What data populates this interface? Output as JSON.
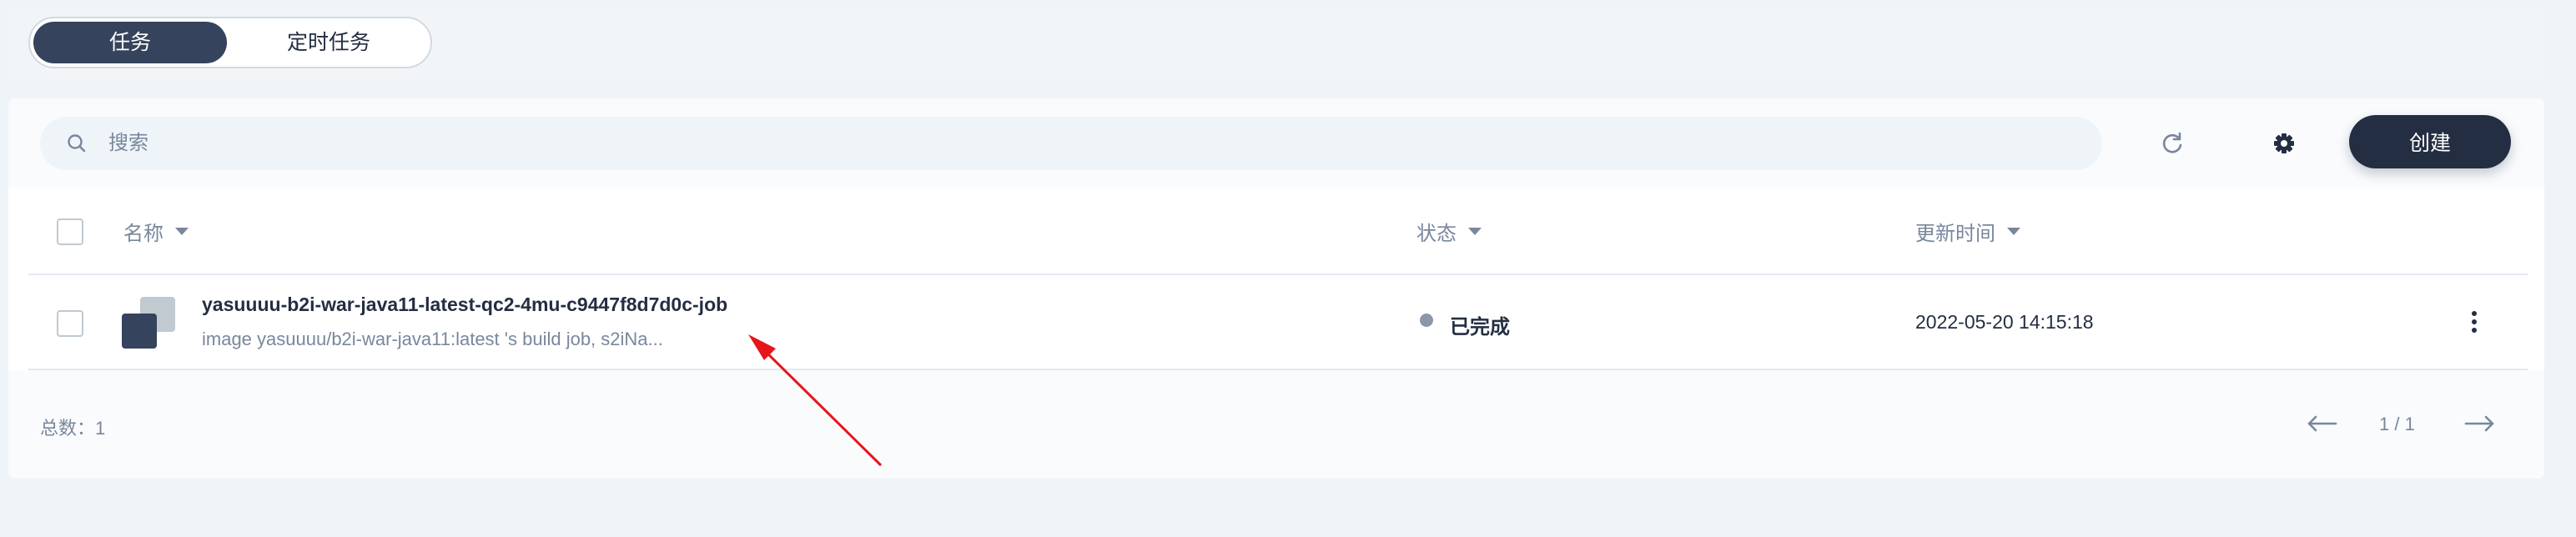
{
  "tabs": [
    {
      "label": "任务",
      "active": true
    },
    {
      "label": "定时任务",
      "active": false
    }
  ],
  "toolbar": {
    "search_placeholder": "搜索",
    "search_value": "",
    "create_label": "创建"
  },
  "table": {
    "columns": {
      "name": "名称",
      "status": "状态",
      "updated": "更新时间"
    },
    "rows": [
      {
        "name": "yasuuuu-b2i-war-java11-latest-qc2-4mu-c9447f8d7d0c-job",
        "description": "image yasuuuu/b2i-war-java11:latest 's build job, s2iNa...",
        "status": "已完成",
        "updated": "2022-05-20 14:15:18"
      }
    ]
  },
  "footer": {
    "total": "总数：1",
    "page": "1 / 1"
  },
  "colors": {
    "accent": "#242e42",
    "annotation_arrow": "#e8141c",
    "status_completed": "#8a97a8"
  },
  "icons": {
    "search": "search-icon",
    "refresh": "refresh-icon",
    "settings": "gear-icon",
    "job": "job-icon",
    "more": "more-vertical-icon",
    "prev": "arrow-left-icon",
    "next": "arrow-right-icon"
  }
}
